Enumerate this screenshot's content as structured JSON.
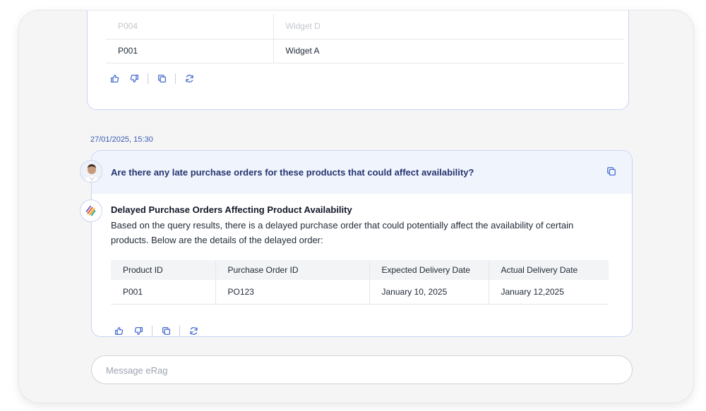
{
  "previous_message": {
    "rows": [
      {
        "product_id": "P004",
        "product_name": "Widget D"
      },
      {
        "product_id": "P001",
        "product_name": "Widget A"
      }
    ]
  },
  "conversation": {
    "timestamp": "27/01/2025, 15:30",
    "question": "Are there any late purchase orders for these products that could affect availability?",
    "answer": {
      "title": "Delayed Purchase Orders Affecting Product Availability",
      "body": "Based on the query results, there is a delayed purchase order that could potentially affect the availability of certain products. Below are the details of the delayed order:",
      "table": {
        "headers": [
          "Product ID",
          "Purchase Order ID",
          "Expected Delivery Date",
          "Actual Delivery Date"
        ],
        "rows": [
          [
            "P001",
            "PO123",
            "January 10, 2025",
            "January 12,2025"
          ]
        ]
      }
    }
  },
  "icons": {
    "like": "thumbs-up-icon",
    "dislike": "thumbs-down-icon",
    "copy": "copy-icon",
    "regenerate": "refresh-icon",
    "user": "user-avatar",
    "bot": "erag-logo-icon"
  },
  "composer": {
    "placeholder": "Message eRag",
    "value": ""
  },
  "colors": {
    "accent": "#4b6fd1",
    "question_text": "#25346f",
    "timestamp": "#3b5bb5",
    "question_bg": "#f0f4fd",
    "card_border": "#c8d4f3"
  }
}
